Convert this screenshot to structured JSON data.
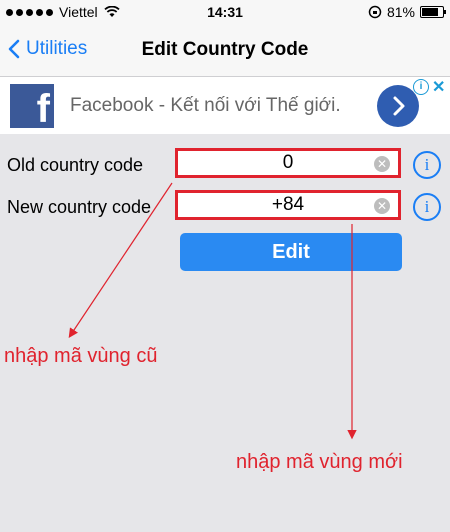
{
  "statusbar": {
    "carrier": "Viettel",
    "time": "14:31",
    "battery": "81%",
    "battery_level": 0.81
  },
  "navbar": {
    "back_label": "Utilities",
    "title": "Edit Country Code"
  },
  "ad": {
    "text": "Facebook - Kết nối với Thế giới.",
    "logo_letter": "f"
  },
  "form": {
    "old_label": "Old country code",
    "old_value": "0",
    "new_label": "New country code",
    "new_value": "+84",
    "edit_label": "Edit"
  },
  "annotations": {
    "old_note": "nhập mã vùng cũ",
    "new_note": "nhập mã vùng mới"
  },
  "colors": {
    "accent": "#1a7ef5",
    "highlight": "#e0232e",
    "button": "#2a8af2"
  }
}
